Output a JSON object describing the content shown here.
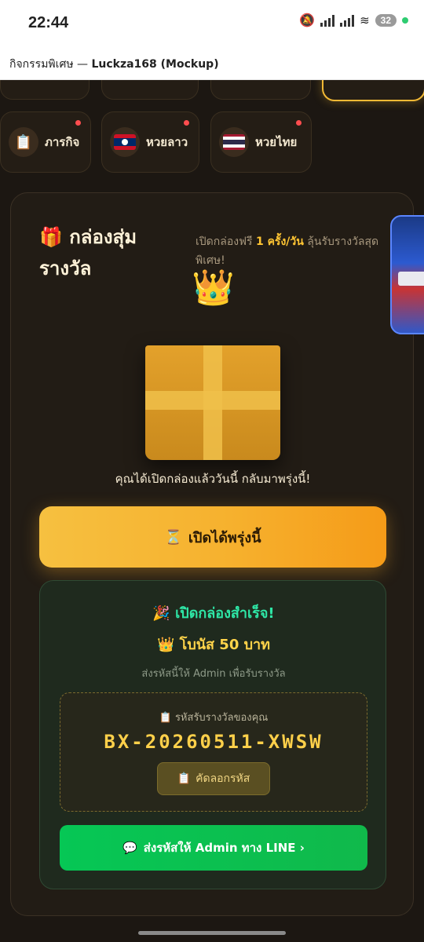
{
  "status_bar": {
    "time": "22:44",
    "battery": "32",
    "icons": [
      "mute-icon",
      "signal-icon",
      "signal-icon",
      "wifi-icon",
      "battery-icon"
    ]
  },
  "app_bar": {
    "title_thai": "กิจกรรมพิเศษ — ",
    "title_bold": "Luckza168 (Mockup)"
  },
  "menu": {
    "items": [
      {
        "label": "ภารกิจ",
        "icon": "clipboard-icon"
      },
      {
        "label": "หวยลาว",
        "icon": "laos-flag-icon"
      },
      {
        "label": "หวยไทย",
        "icon": "thailand-flag-icon"
      }
    ]
  },
  "card": {
    "title": "กล่องสุ่มรางวัล",
    "title_icon": "🎁",
    "desc_prefix": "เปิดกล่องฟรี ",
    "desc_highlight": "1 ครั้ง/วัน",
    "desc_suffix": " ลุ้นรับรางวัลสุดพิเศษ!",
    "crown": "👑",
    "opened_message": "คุณได้เปิดกล่องแล้ววันนี้ กลับมาพรุ่งนี้!",
    "cta_icon": "⏳",
    "cta_label": "เปิดได้พรุ่งนี้"
  },
  "result": {
    "title_icon": "🎉",
    "title": "เปิดกล่องสำเร็จ!",
    "bonus_icon": "👑",
    "bonus": "โบนัส 50 บาท",
    "note": "ส่งรหัสนี้ให้ Admin เพื่อรับรางวัล",
    "code_label_icon": "📋",
    "code_label": "รหัสรับรางวัลของคุณ",
    "code": "BX-20260511-XWSW",
    "copy_icon": "📋",
    "copy_label": "คัดลอกรหัส",
    "line_icon": "💬",
    "line_label": "ส่งรหัสให้ Admin ทาง LINE ›"
  },
  "colors": {
    "accent": "#f6b12e",
    "highlight": "#ffc533",
    "success": "#2ee6a6",
    "line_green": "#06c755",
    "badge_red": "#ff4d4f"
  }
}
